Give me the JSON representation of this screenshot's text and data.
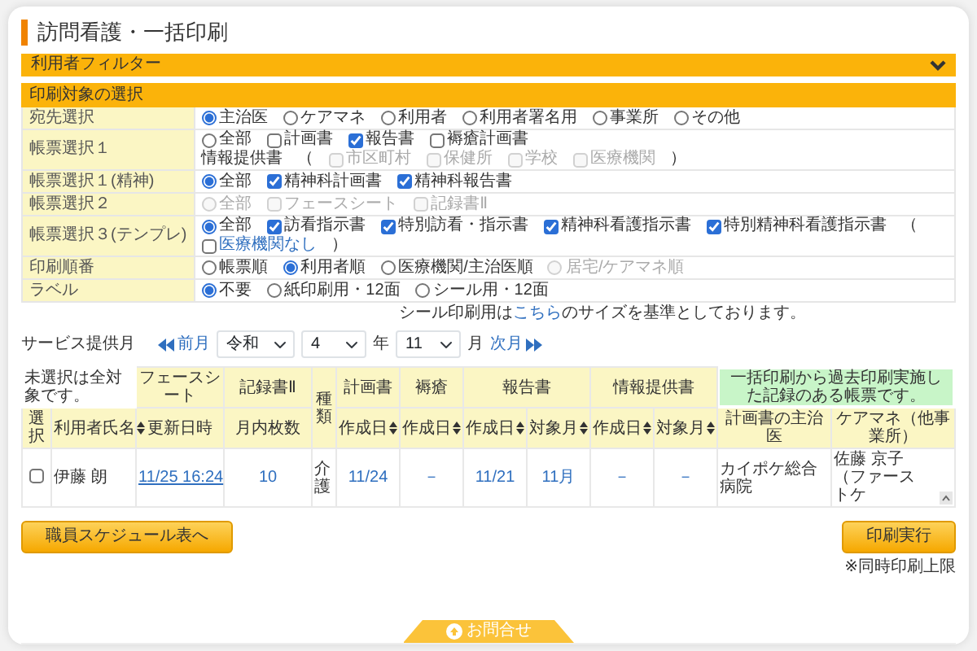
{
  "title": "訪問看護・一括印刷",
  "filter": {
    "label": "利用者フィルター",
    "expanded": false
  },
  "form": {
    "heading": "印刷対象の選択",
    "rows": [
      {
        "label": "宛先選択",
        "lines": [
          [
            {
              "kind": "radio",
              "label": "主治医",
              "checked": true,
              "disabled": false
            },
            {
              "kind": "radio",
              "label": "ケアマネ",
              "checked": false,
              "disabled": false
            },
            {
              "kind": "radio",
              "label": "利用者",
              "checked": false,
              "disabled": false
            },
            {
              "kind": "radio",
              "label": "利用者署名用",
              "checked": false,
              "disabled": false
            },
            {
              "kind": "radio",
              "label": "事業所",
              "checked": false,
              "disabled": false
            },
            {
              "kind": "radio",
              "label": "その他",
              "checked": false,
              "disabled": false
            }
          ]
        ]
      },
      {
        "label": "帳票選択１",
        "lines": [
          [
            {
              "kind": "radio",
              "label": "全部",
              "checked": false,
              "disabled": false
            },
            {
              "kind": "checkbox",
              "label": "計画書",
              "checked": false,
              "disabled": false
            },
            {
              "kind": "checkbox",
              "label": "報告書",
              "checked": true,
              "disabled": false
            },
            {
              "kind": "checkbox",
              "label": "褥瘡計画書",
              "checked": false,
              "disabled": false
            }
          ],
          [
            {
              "kind": "text",
              "label": "情報提供書"
            },
            {
              "kind": "text",
              "label": "（"
            },
            {
              "kind": "checkbox",
              "label": "市区町村",
              "checked": false,
              "disabled": true
            },
            {
              "kind": "checkbox",
              "label": "保健所",
              "checked": false,
              "disabled": true
            },
            {
              "kind": "checkbox",
              "label": "学校",
              "checked": false,
              "disabled": true
            },
            {
              "kind": "checkbox",
              "label": "医療機関",
              "checked": false,
              "disabled": true
            },
            {
              "kind": "text",
              "label": "）"
            }
          ]
        ]
      },
      {
        "label": "帳票選択１(精神)",
        "lines": [
          [
            {
              "kind": "radio",
              "label": "全部",
              "checked": true,
              "disabled": false
            },
            {
              "kind": "checkbox",
              "label": "精神科計画書",
              "checked": true,
              "disabled": false
            },
            {
              "kind": "checkbox",
              "label": "精神科報告書",
              "checked": true,
              "disabled": false
            }
          ]
        ]
      },
      {
        "label": "帳票選択２",
        "lines": [
          [
            {
              "kind": "radio",
              "label": "全部",
              "checked": false,
              "disabled": true
            },
            {
              "kind": "checkbox",
              "label": "フェースシート",
              "checked": false,
              "disabled": true
            },
            {
              "kind": "checkbox",
              "label": "記録書Ⅱ",
              "checked": false,
              "disabled": true
            }
          ]
        ]
      },
      {
        "label": "帳票選択３(テンプレ)",
        "lines": [
          [
            {
              "kind": "radio",
              "label": "全部",
              "checked": true,
              "disabled": false
            },
            {
              "kind": "checkbox",
              "label": "訪看指示書",
              "checked": true,
              "disabled": false
            },
            {
              "kind": "checkbox",
              "label": "特別訪看・指示書",
              "checked": true,
              "disabled": false
            },
            {
              "kind": "checkbox",
              "label": "精神科看護指示書",
              "checked": true,
              "disabled": false
            },
            {
              "kind": "checkbox",
              "label": "特別精神科看護指示書",
              "checked": true,
              "disabled": false
            },
            {
              "kind": "text",
              "label": "（"
            },
            {
              "kind": "checkbox-link",
              "label": "医療機関なし",
              "checked": false,
              "disabled": false
            },
            {
              "kind": "text",
              "label": "）"
            }
          ]
        ]
      },
      {
        "label": "印刷順番",
        "lines": [
          [
            {
              "kind": "radio",
              "label": "帳票順",
              "checked": false,
              "disabled": false
            },
            {
              "kind": "radio",
              "label": "利用者順",
              "checked": true,
              "disabled": false
            },
            {
              "kind": "radio",
              "label": "医療機関/主治医順",
              "checked": false,
              "disabled": false
            },
            {
              "kind": "radio",
              "label": "居宅/ケアマネ順",
              "checked": false,
              "disabled": true
            }
          ]
        ]
      },
      {
        "label": "ラベル",
        "lines": [
          [
            {
              "kind": "radio",
              "label": "不要",
              "checked": true,
              "disabled": false
            },
            {
              "kind": "radio",
              "label": "紙印刷用・12面",
              "checked": false,
              "disabled": false
            },
            {
              "kind": "radio",
              "label": "シール用・12面",
              "checked": false,
              "disabled": false
            }
          ]
        ]
      }
    ]
  },
  "size_note": {
    "before": "シール印刷用は",
    "link": "こちら",
    "after": "のサイズを基準としております。"
  },
  "month_nav": {
    "label": "サービス提供月",
    "prev": "前月",
    "era": "令和",
    "year": "4",
    "year_unit": "年",
    "month": "11",
    "month_unit": "月",
    "next": "次月"
  },
  "table": {
    "groups": [
      {
        "kind": "note",
        "label": "未選択は全対象です。",
        "columns": [
          {
            "label": "選択",
            "sortable": false
          },
          {
            "label": "利用者氏名",
            "sortable": true
          }
        ]
      },
      {
        "kind": "header",
        "label": "フェースシート",
        "columns": [
          {
            "label": "更新日時",
            "sortable": false
          }
        ]
      },
      {
        "kind": "header",
        "label": "記録書Ⅱ",
        "columns": [
          {
            "label": "月内枚数",
            "sortable": false
          }
        ]
      },
      {
        "kind": "header",
        "label": "種類"
      },
      {
        "kind": "header",
        "label": "計画書",
        "columns": [
          {
            "label": "作成日",
            "sortable": true
          }
        ]
      },
      {
        "kind": "header",
        "label": "褥瘡",
        "columns": [
          {
            "label": "作成日",
            "sortable": true
          }
        ]
      },
      {
        "kind": "header",
        "label": "報告書",
        "columns": [
          {
            "label": "作成日",
            "sortable": true
          },
          {
            "label": "対象月",
            "sortable": true
          }
        ]
      },
      {
        "kind": "header",
        "label": "情報提供書",
        "columns": [
          {
            "label": "作成日",
            "sortable": true
          },
          {
            "label": "対象月",
            "sortable": true
          }
        ]
      },
      {
        "kind": "legend",
        "label": "一括印刷から過去印刷実施した記録のある帳票です。",
        "columns": [
          {
            "label": "計画書の主治医",
            "sortable": false
          },
          {
            "label": "ケアマネ（他事業所）",
            "sortable": false
          }
        ]
      }
    ],
    "rows": [
      {
        "selected": false,
        "cells": [
          {
            "kind": "text",
            "text": "伊藤 朗"
          },
          {
            "kind": "link",
            "text": "11/25 16:24"
          },
          {
            "kind": "value",
            "text": "10"
          },
          {
            "kind": "text",
            "text": "介護"
          },
          {
            "kind": "value",
            "text": "11/24"
          },
          {
            "kind": "value",
            "text": "－"
          },
          {
            "kind": "value",
            "text": "11/21"
          },
          {
            "kind": "value",
            "text": "11月"
          },
          {
            "kind": "value",
            "text": "－"
          },
          {
            "kind": "value",
            "text": "－"
          },
          {
            "kind": "text",
            "text": "カイポケ総合病院"
          },
          {
            "kind": "text",
            "text": "佐藤 京子（ファーストケ"
          }
        ]
      }
    ]
  },
  "buttons": {
    "schedule": "職員スケジュール表へ",
    "print": "印刷実行",
    "print_note": "※同時印刷上限"
  },
  "contact_tab": "お問合せ"
}
